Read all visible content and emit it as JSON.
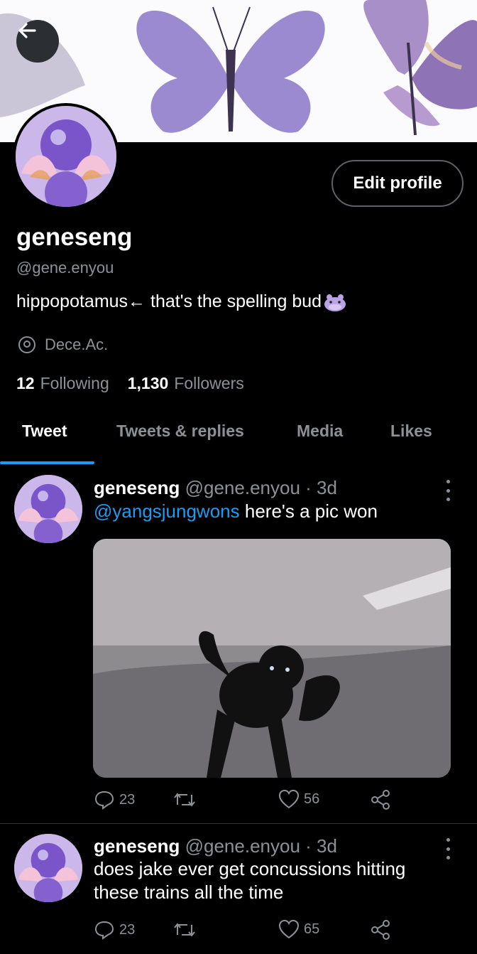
{
  "header": {
    "back_icon": "arrow-left-icon"
  },
  "profile": {
    "display_name": "geneseng",
    "handle": "@gene.enyou",
    "bio": "hippopotamus← that's the spelling bud",
    "bio_emoji": "hippo-emoji",
    "location": "Dece.Ac.",
    "edit_button": "Edit profile",
    "following_count": "12",
    "following_label": "Following",
    "followers_count": "1,130",
    "followers_label": "Followers"
  },
  "tabs": [
    {
      "label": "Tweet",
      "active": true
    },
    {
      "label": "Tweets & replies",
      "active": false
    },
    {
      "label": "Media",
      "active": false
    },
    {
      "label": "Likes",
      "active": false
    }
  ],
  "tweets": [
    {
      "name": "geneseng",
      "handle_time": "@gene.enyou · 3d",
      "mention": "@yangsjungwons",
      "text": " here's a pic won",
      "has_image": true,
      "replies": "23",
      "likes": "56"
    },
    {
      "name": "geneseng",
      "handle_time": "@gene.enyou · 3d",
      "text": "does jake ever get concussions hitting these trains all the time",
      "replies": "23",
      "likes": "65"
    }
  ],
  "colors": {
    "accent": "#1d9bf0",
    "muted": "#8b9197",
    "background": "#000000"
  }
}
